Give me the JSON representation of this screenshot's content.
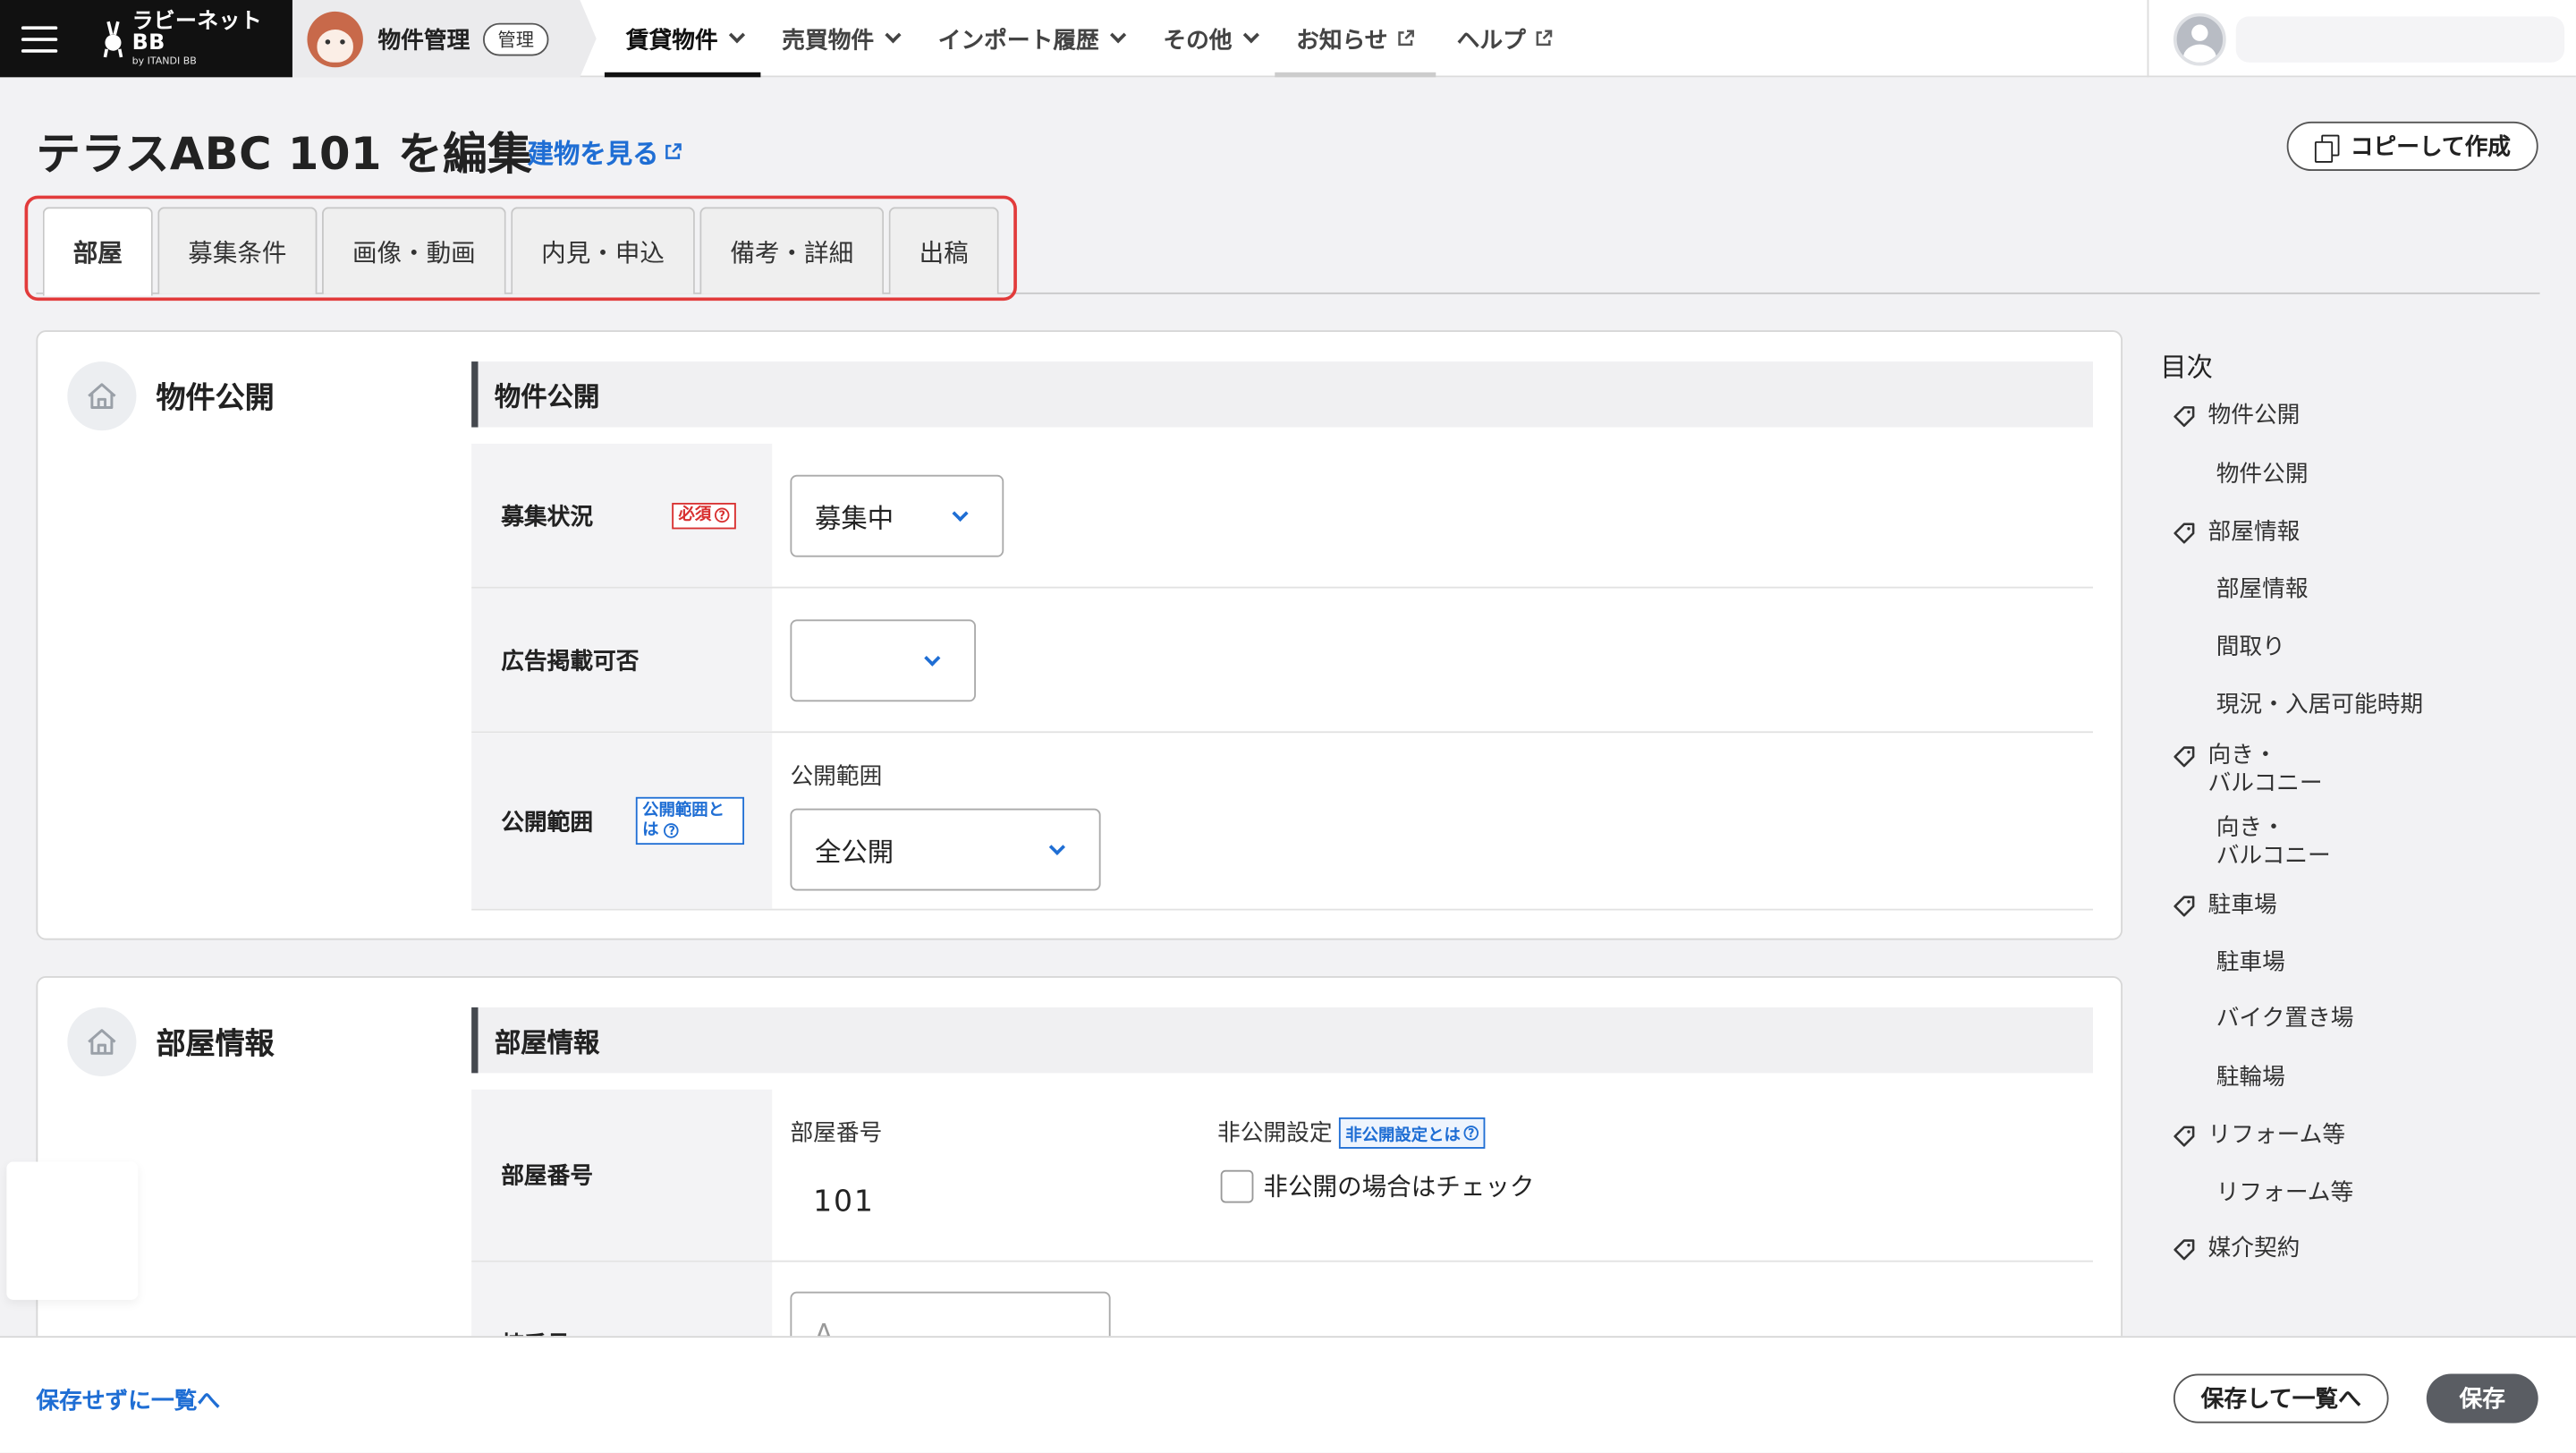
{
  "brand": {
    "name": "ラビーネットBB",
    "sub": "by ITANDI BB"
  },
  "module": {
    "title": "物件管理",
    "badge": "管理"
  },
  "nav": [
    {
      "label": "賃貸物件",
      "icon": "chevron-down-icon",
      "active": true
    },
    {
      "label": "売買物件",
      "icon": "chevron-down-icon"
    },
    {
      "label": "インポート履歴",
      "icon": "chevron-down-icon"
    },
    {
      "label": "その他",
      "icon": "chevron-down-icon"
    },
    {
      "label": "お知らせ",
      "icon": "external-link-icon"
    },
    {
      "label": "ヘルプ",
      "icon": "external-link-icon"
    }
  ],
  "header": {
    "title": "テラスABC 101 を編集",
    "building_link": "建物を見る",
    "copy_button": "コピーして作成"
  },
  "tabs": [
    "部屋",
    "募集条件",
    "画像・動画",
    "内見・申込",
    "備考・詳細",
    "出稿"
  ],
  "active_tab": "部屋",
  "sections": {
    "publish": {
      "side_title": "物件公開",
      "head": "物件公開",
      "recruit_status": {
        "label": "募集状況",
        "required": "必須",
        "value": "募集中"
      },
      "ad_permission": {
        "label": "広告掲載可否",
        "value": ""
      },
      "scope": {
        "label": "公開範囲",
        "help": "公開範囲とは",
        "caption": "公開範囲",
        "value": "全公開"
      }
    },
    "room": {
      "side_title": "部屋情報",
      "head": "部屋情報",
      "room_number": {
        "label": "部屋番号",
        "caption": "部屋番号",
        "value": "101"
      },
      "nonpublic": {
        "caption": "非公開設定",
        "help": "非公開設定とは",
        "checkbox_label": "非公開の場合はチェック"
      },
      "building_number": {
        "label": "棟番号",
        "placeholder": "A"
      }
    }
  },
  "toc": {
    "title": "目次",
    "items": [
      {
        "label": "物件公開",
        "level": 1
      },
      {
        "label": "物件公開",
        "level": 2
      },
      {
        "label": "部屋情報",
        "level": 1
      },
      {
        "label": "部屋情報",
        "level": 2
      },
      {
        "label": "間取り",
        "level": 2
      },
      {
        "label": "現況・入居可能時期",
        "level": 2
      },
      {
        "label": "向き・\nバルコニー",
        "level": 1
      },
      {
        "label": "向き・\nバルコニー",
        "level": 2
      },
      {
        "label": "駐車場",
        "level": 1
      },
      {
        "label": "駐車場",
        "level": 2
      },
      {
        "label": "バイク置き場",
        "level": 2
      },
      {
        "label": "駐輪場",
        "level": 2
      },
      {
        "label": "リフォーム等",
        "level": 1
      },
      {
        "label": "リフォーム等",
        "level": 2
      },
      {
        "label": "媒介契約",
        "level": 1
      }
    ]
  },
  "footer": {
    "cancel_link": "保存せずに一覧へ",
    "save_list": "保存して一覧へ",
    "save": "保存"
  },
  "colors": {
    "accent": "#1f6ed4",
    "required": "#d83030",
    "highlight": "#e23b3b",
    "dark": "#111111"
  }
}
